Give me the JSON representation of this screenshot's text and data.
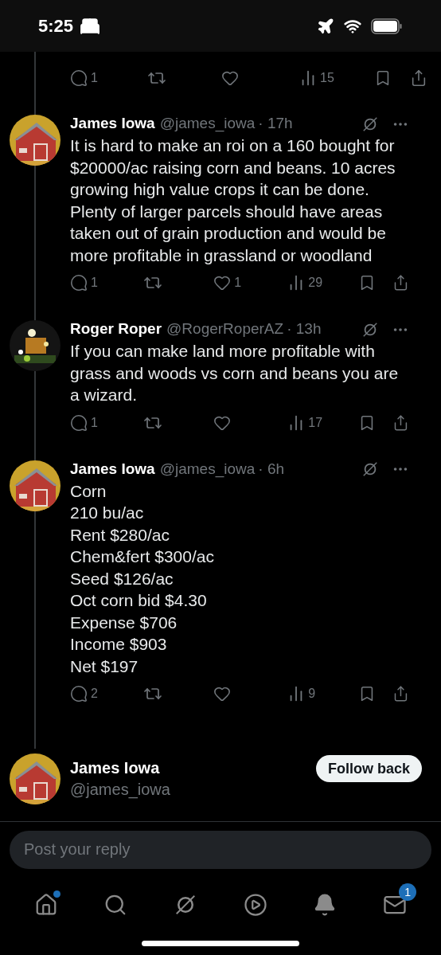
{
  "status_bar": {
    "time": "5:25"
  },
  "partial_post": {
    "stats": {
      "replies": "1",
      "views": "15"
    }
  },
  "posts": [
    {
      "author": "James Iowa",
      "handle": "@james_iowa",
      "time": "· 17h",
      "text": "It is hard to make an roi on a 160 bought for $20000/ac raising corn and beans. 10 acres growing high value crops it can be done. Plenty of larger parcels should have areas taken out of grain production and would be more profitable in grassland or woodland",
      "stats": {
        "replies": "1",
        "likes": "1",
        "views": "29"
      }
    },
    {
      "author": "Roger Roper",
      "handle": "@RogerRoperAZ",
      "time": "· 13h",
      "text": "If you can make land more profitable with grass and woods vs corn and beans you are a wizard.",
      "stats": {
        "replies": "1",
        "views": "17"
      }
    },
    {
      "author": "James Iowa",
      "handle": "@james_iowa",
      "time": "· 6h",
      "text": "Corn\n210 bu/ac\nRent $280/ac\nChem&fert $300/ac\nSeed $126/ac\nOct corn bid $4.30\nExpense $706\nIncome $903\nNet $197",
      "stats": {
        "replies": "2",
        "views": "9"
      }
    }
  ],
  "user_card": {
    "name": "James Iowa",
    "handle": "@james_iowa",
    "button": "Follow back"
  },
  "reply": {
    "placeholder": "Post your reply"
  },
  "tab_bar": [
    {
      "kind": "home",
      "dot": true
    },
    {
      "kind": "search"
    },
    {
      "kind": "grok"
    },
    {
      "kind": "video"
    },
    {
      "kind": "notifications"
    },
    {
      "kind": "messages",
      "badge": "1"
    }
  ]
}
